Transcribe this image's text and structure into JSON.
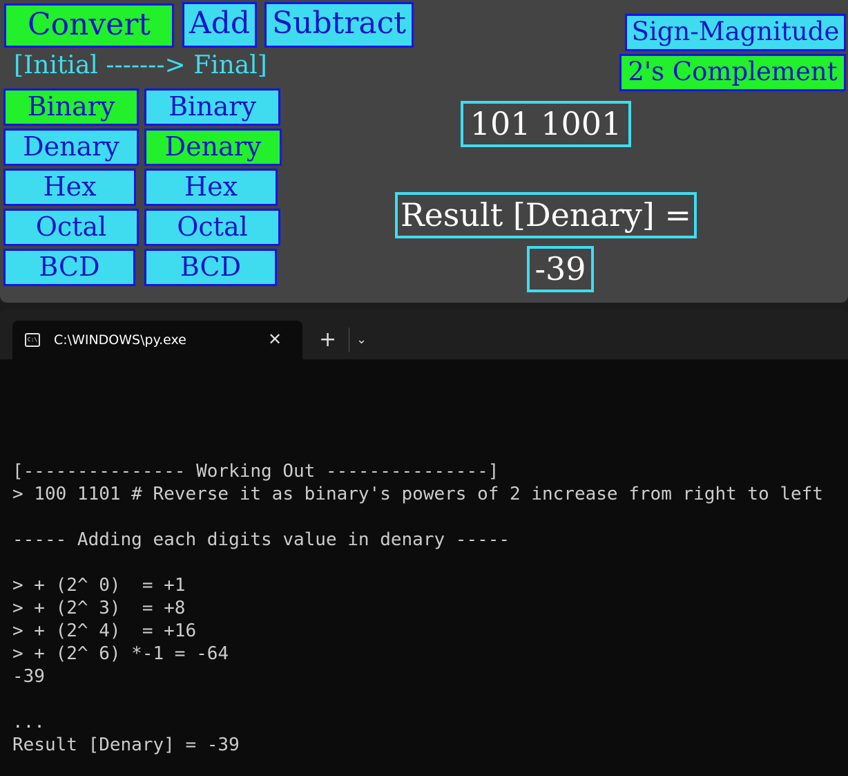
{
  "app": {
    "modes": {
      "convert": "Convert",
      "add": "Add",
      "subtract": "Subtract"
    },
    "hint": "[Initial -------> Final]",
    "initial_options": [
      "Binary",
      "Denary",
      "Hex",
      "Octal",
      "BCD"
    ],
    "final_options": [
      "Binary",
      "Denary",
      "Hex",
      "Octal",
      "BCD"
    ],
    "initial_selected": "Binary",
    "final_selected": "Denary",
    "representation": {
      "sign_magnitude": "Sign-Magnitude",
      "twos_complement": "2's Complement",
      "selected": "2's Complement"
    },
    "input_value": "101 1001",
    "result_label": "Result [Denary] =",
    "result_value": "-39"
  },
  "terminal": {
    "tab_title": "C:\\WINDOWS\\py.exe",
    "tab_icon": "console-icon",
    "close_glyph": "✕",
    "new_tab_glyph": "+",
    "dropdown_glyph": "⌄",
    "lines": [
      "[--------------- Working Out ---------------]",
      "> 100 1101 # Reverse it as binary's powers of 2 increase from right to left",
      "----- Adding each digits value in denary -----",
      "> + (2^ 0)  = +1",
      "> + (2^ 3)  = +8",
      "> + (2^ 4)  = +16",
      "> + (2^ 6) *-1 = -64",
      "-39",
      "...",
      "Result [Denary] = -39"
    ]
  },
  "colors": {
    "button_bg": "#3fdcf0",
    "button_selected_bg": "#22f02a",
    "button_border": "#1414e6",
    "button_text": "#1414c8",
    "app_bg": "#444444",
    "terminal_bg": "#0c0c0c",
    "terminal_text": "#cccccc"
  }
}
